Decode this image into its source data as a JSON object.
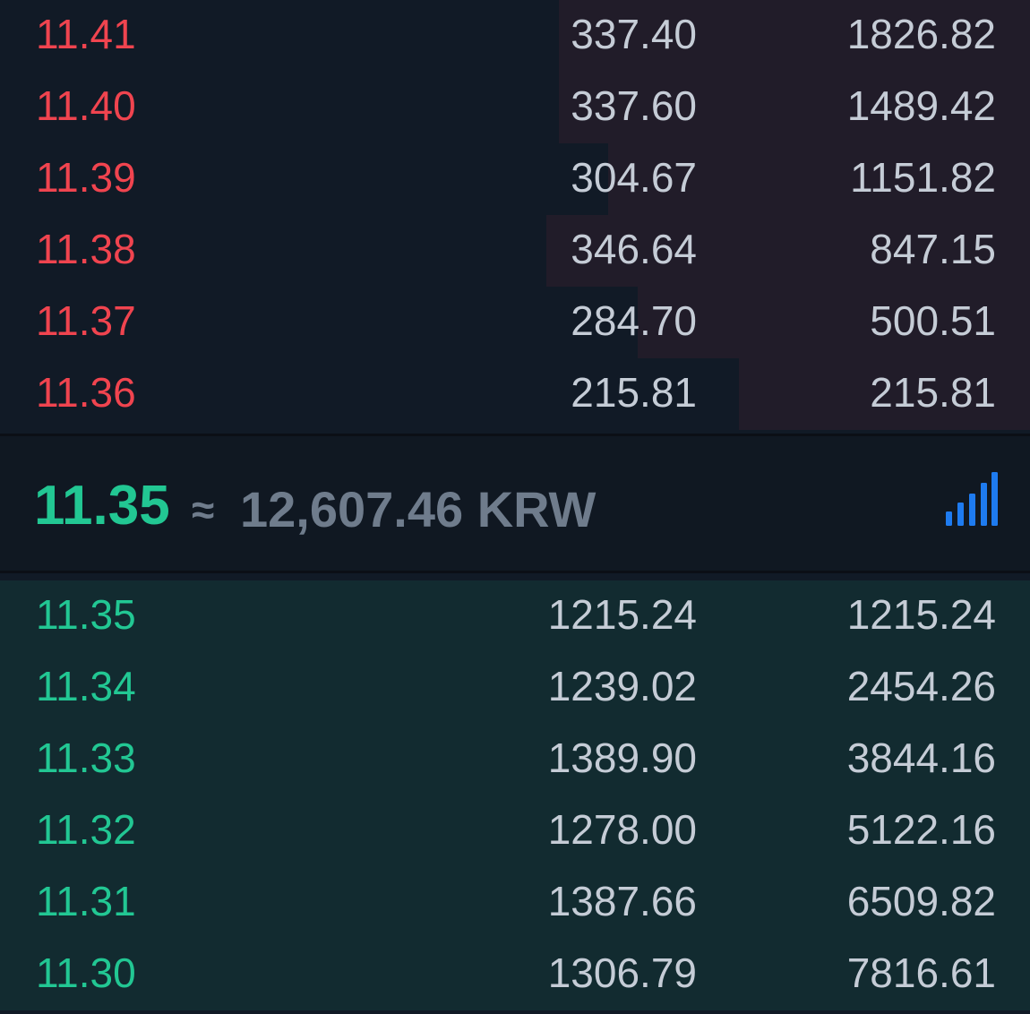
{
  "asks": [
    {
      "price": "11.41",
      "amount": "337.40",
      "total": "1826.82",
      "depth": 0.457
    },
    {
      "price": "11.40",
      "amount": "337.60",
      "total": "1489.42",
      "depth": 0.457
    },
    {
      "price": "11.39",
      "amount": "304.67",
      "total": "1151.82",
      "depth": 0.41
    },
    {
      "price": "11.38",
      "amount": "346.64",
      "total": "847.15",
      "depth": 0.47
    },
    {
      "price": "11.37",
      "amount": "284.70",
      "total": "500.51",
      "depth": 0.381
    },
    {
      "price": "11.36",
      "amount": "215.81",
      "total": "215.81",
      "depth": 0.283
    }
  ],
  "mid": {
    "price": "11.35",
    "approx_symbol": "≈",
    "converted": "12,607.46 KRW",
    "signal_icon": "signal-bars-icon"
  },
  "bids": [
    {
      "price": "11.35",
      "amount": "1215.24",
      "total": "1215.24",
      "depth": 1.0
    },
    {
      "price": "11.34",
      "amount": "1239.02",
      "total": "2454.26",
      "depth": 1.0
    },
    {
      "price": "11.33",
      "amount": "1389.90",
      "total": "3844.16",
      "depth": 1.0
    },
    {
      "price": "11.32",
      "amount": "1278.00",
      "total": "5122.16",
      "depth": 1.0
    },
    {
      "price": "11.31",
      "amount": "1387.66",
      "total": "6509.82",
      "depth": 1.0
    },
    {
      "price": "11.30",
      "amount": "1306.79",
      "total": "7816.61",
      "depth": 1.0
    }
  ],
  "colors": {
    "ask": "#f0444f",
    "bid": "#22c793",
    "accent": "#1e7bf0"
  }
}
